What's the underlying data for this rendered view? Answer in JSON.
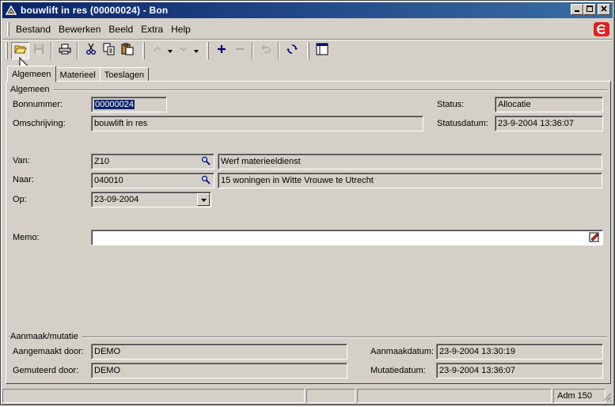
{
  "window": {
    "title": "bouwlift in res (00000024) - Bon"
  },
  "menu": {
    "items": [
      "Bestand",
      "Bewerken",
      "Beeld",
      "Extra",
      "Help"
    ]
  },
  "tabs": [
    "Algemeen",
    "Materieel",
    "Toeslagen"
  ],
  "algemeen": {
    "section_label": "Algemeen",
    "bonnummer_label": "Bonnummer:",
    "bonnummer_value": "00000024",
    "omschrijving_label": "Omschrijving:",
    "omschrijving_value": "bouwlift in res",
    "status_label": "Status:",
    "status_value": "Allocatie",
    "statusdatum_label": "Statusdatum:",
    "statusdatum_value": "23-9-2004 13:36:07",
    "van_label": "Van:",
    "van_code": "Z10",
    "van_desc": "Werf materieeldienst",
    "naar_label": "Naar:",
    "naar_code": "040010",
    "naar_desc": "15 woningen in Witte Vrouwe te Utrecht",
    "op_label": "Op:",
    "op_value": "23-09-2004",
    "memo_label": "Memo:",
    "memo_value": ""
  },
  "mutatie": {
    "section_label": "Aanmaak/mutatie",
    "aangemaakt_label": "Aangemaakt door:",
    "aangemaakt_value": "DEMO",
    "gemuteerd_label": "Gemuteerd door:",
    "gemuteerd_value": "DEMO",
    "aanmaakdatum_label": "Aanmaakdatum:",
    "aanmaakdatum_value": "23-9-2004 13:30:19",
    "mutatiedatum_label": "Mutatiedatum:",
    "mutatiedatum_value": "23-9-2004 13:36:07"
  },
  "statusbar": {
    "cells": [
      "",
      "",
      "",
      "Adm 150"
    ]
  },
  "colors": {
    "titlebar_start": "#0a246a",
    "titlebar_end": "#3a6ea5",
    "face": "#d4d0c8",
    "brand": "#e02020"
  }
}
